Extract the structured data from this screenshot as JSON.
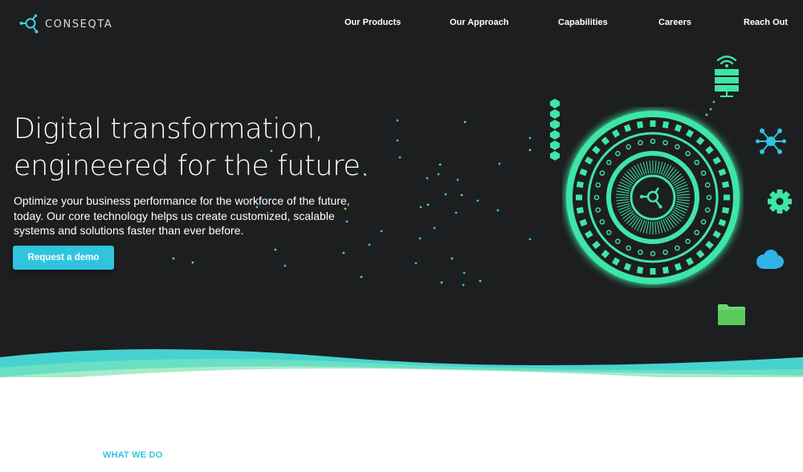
{
  "brand": {
    "name": "CONSEQTA",
    "accent_color": "#31c4df",
    "glow_color": "#3ee6a6"
  },
  "nav": {
    "items": [
      {
        "label": "Our Products"
      },
      {
        "label": "Our Approach"
      },
      {
        "label": "Capabilities"
      },
      {
        "label": "Careers"
      },
      {
        "label": "Reach Out"
      }
    ]
  },
  "hero": {
    "headline_line1": "Digital transformation,",
    "headline_line2": "engineered for the future.",
    "subtext": "Optimize your business performance for the workforce of the future, today. Our core technology helps us create customized, scalable systems and solutions faster than ever before.",
    "cta_label": "Request a demo"
  },
  "icons": [
    "wifi-icon",
    "server-icon",
    "hexagon-stack-icon",
    "network-icon",
    "gear-icon",
    "cloud-icon",
    "folder-icon"
  ],
  "section": {
    "label": "WHAT WE DO"
  }
}
